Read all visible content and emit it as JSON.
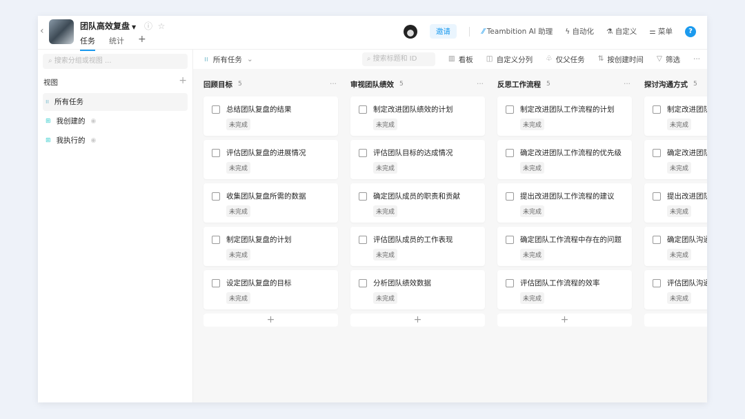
{
  "header": {
    "project_title": "团队高效复盘",
    "tabs": [
      "任务",
      "统计"
    ],
    "invite": "邀请",
    "ai": "Teambition AI 助理",
    "automation": "自动化",
    "customize": "自定义",
    "menu": "菜单",
    "help": "?"
  },
  "sidebar": {
    "search_placeholder": "搜索分组或视图 ...",
    "section": "视图",
    "items": [
      {
        "label": "所有任务"
      },
      {
        "label": "我创建的"
      },
      {
        "label": "我执行的"
      }
    ]
  },
  "toolbar": {
    "view": "所有任务",
    "search_placeholder": "搜索标题和 ID",
    "buttons": [
      "看板",
      "自定义分列",
      "仅父任务",
      "按创建时间",
      "筛选"
    ]
  },
  "status_label": "未完成",
  "columns": [
    {
      "title": "回顾目标",
      "count": "5",
      "tasks": [
        "总结团队复盘的结果",
        "评估团队复盘的进展情况",
        "收集团队复盘所需的数据",
        "制定团队复盘的计划",
        "设定团队复盘的目标"
      ]
    },
    {
      "title": "审视团队绩效",
      "count": "5",
      "tasks": [
        "制定改进团队绩效的计划",
        "评估团队目标的达成情况",
        "确定团队成员的职责和贡献",
        "评估团队成员的工作表现",
        "分析团队绩效数据"
      ]
    },
    {
      "title": "反思工作流程",
      "count": "5",
      "tasks": [
        "制定改进团队工作流程的计划",
        "确定改进团队工作流程的优先级",
        "提出改进团队工作流程的建议",
        "确定团队工作流程中存在的问题",
        "评估团队工作流程的效率"
      ]
    },
    {
      "title": "探讨沟通方式",
      "count": "5",
      "tasks": [
        "制定改进团队沟通方式的计划",
        "确定改进团队沟通方式的优先级",
        "提出改进团队沟通方式的建议",
        "确定团队沟通中存在的问题",
        "评估团队沟通方式的效率"
      ]
    }
  ]
}
